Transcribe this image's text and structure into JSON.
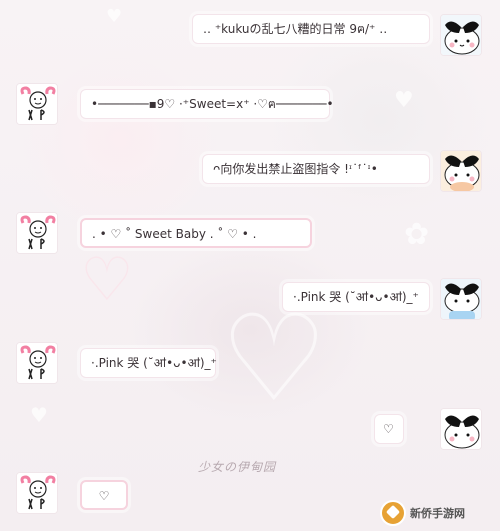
{
  "chat": {
    "messages": [
      {
        "side": "right",
        "text": "‥ ⁺kukuの乱七八糟的日常 9ฅ/⁺ ‥"
      },
      {
        "side": "left",
        "text": "•───────▪9♡ ·⁺Sweet=x⁺ ·♡ฅ───────•"
      },
      {
        "side": "right",
        "text": "ᴖ向你发出禁止盗图指令 !ᶦ˙ᶠ˙ᶦ•"
      },
      {
        "side": "left",
        "text": ". • ♡ ˚ Sweet Baby . ˚ ♡ • ."
      },
      {
        "side": "right",
        "text": "·.Pink 哭 (˘ॴ•ᴗ•ॴ)_⁺"
      },
      {
        "side": "left",
        "text": "·.Pink 哭 (˘ॴ•ᴗ•ॴ)_⁺"
      },
      {
        "side": "right",
        "text": "♡"
      },
      {
        "side": "left",
        "text": "♡"
      }
    ]
  },
  "background": {
    "caption": "少女の伊甸园"
  },
  "watermark": {
    "text": "新侨手游网"
  },
  "colors": {
    "bubble_border": "#f3e4ea",
    "accent_pink": "#f6d3de"
  }
}
